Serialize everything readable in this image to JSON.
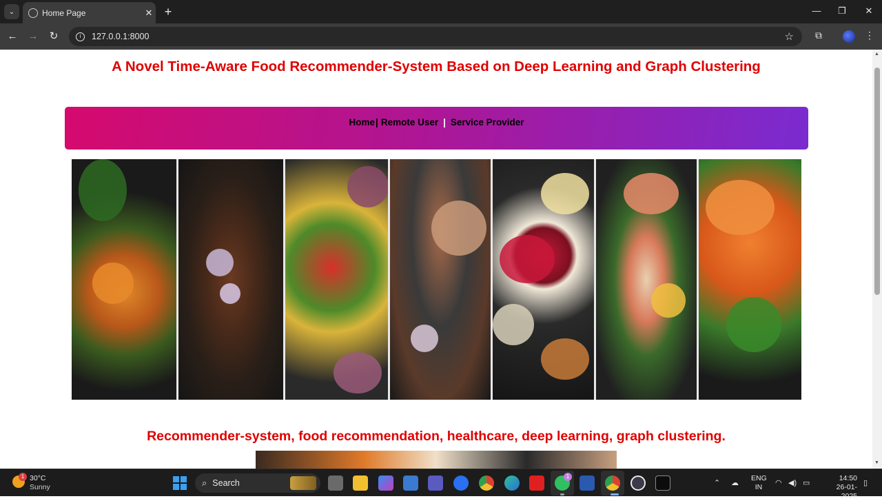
{
  "browser": {
    "tab_title": "Home Page",
    "url": "127.0.0.1:8000"
  },
  "page": {
    "title": "A Novel Time-Aware Food Recommender-System Based on Deep Learning and Graph Clustering",
    "nav": {
      "home": "Home",
      "separator": "|",
      "remote_user": "Remote User",
      "service_provider": "Service Provider"
    },
    "hero_image": "food collage",
    "keywords": "Recommender-system, food recommendation, healthcare, deep learning, graph clustering."
  },
  "taskbar": {
    "weather": {
      "temp": "30°C",
      "desc": "Sunny",
      "badge": "1"
    },
    "search_label": "Search",
    "whatsapp_badge": "1",
    "lang_line1": "ENG",
    "lang_line2": "IN",
    "time": "14:50",
    "date": "26-01-2025"
  },
  "colors": {
    "title_red": "#e00000",
    "nav_gradient_start": "#d50a6e",
    "nav_gradient_end": "#7a2bd0"
  }
}
